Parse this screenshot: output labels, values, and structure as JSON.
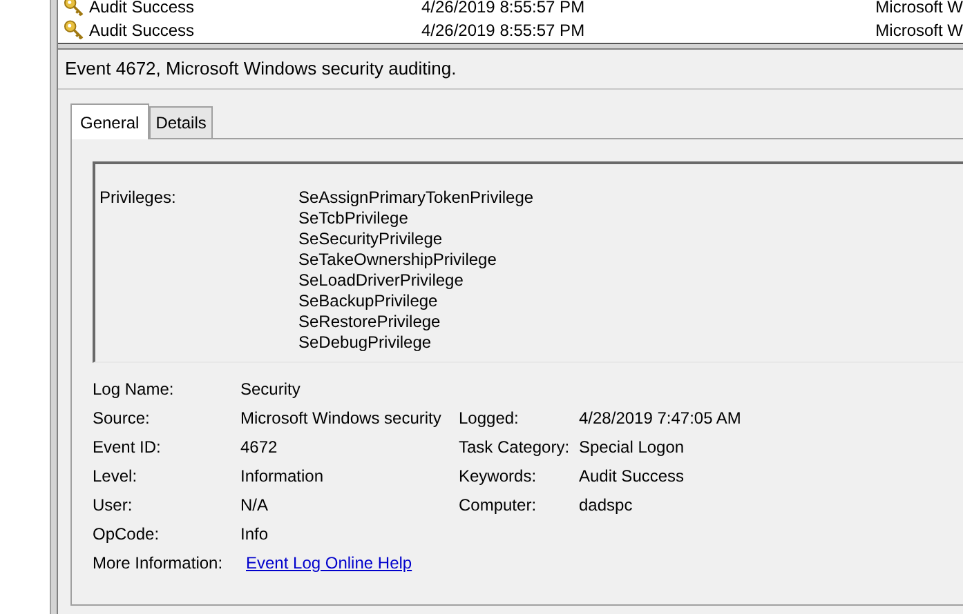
{
  "event_list": {
    "rows": [
      {
        "keywords": "Audit Success",
        "date_time": "4/26/2019 8:55:57 PM",
        "source": "Microsoft W"
      },
      {
        "keywords": "Audit Success",
        "date_time": "4/26/2019 8:55:57 PM",
        "source": "Microsoft W"
      }
    ]
  },
  "event_header": {
    "title": "Event 4672, Microsoft Windows security auditing."
  },
  "tabs": [
    {
      "label": "General",
      "selected": true
    },
    {
      "label": "Details",
      "selected": false
    }
  ],
  "description": {
    "label": "Privileges:",
    "values": [
      "SeAssignPrimaryTokenPrivilege",
      "SeTcbPrivilege",
      "SeSecurityPrivilege",
      "SeTakeOwnershipPrivilege",
      "SeLoadDriverPrivilege",
      "SeBackupPrivilege",
      "SeRestorePrivilege",
      "SeDebugPrivilege"
    ]
  },
  "properties": [
    {
      "label": "Log Name:",
      "value": "Security"
    },
    {
      "label": "Source:",
      "value": "Microsoft Windows security",
      "label_2": "Logged:",
      "value_2": "4/28/2019 7:47:05 AM"
    },
    {
      "label": "Event ID:",
      "value": "4672",
      "label_2": "Task Category:",
      "value_2": "Special Logon"
    },
    {
      "label": "Level:",
      "value": "Information",
      "label_2": "Keywords:",
      "value_2": "Audit Success"
    },
    {
      "label": "User:",
      "value": "N/A",
      "label_2": "Computer:",
      "value_2": "dadspc"
    },
    {
      "label": "OpCode:",
      "value": "Info"
    },
    {
      "label": "More Information:",
      "link": "Event Log Online Help"
    }
  ]
}
